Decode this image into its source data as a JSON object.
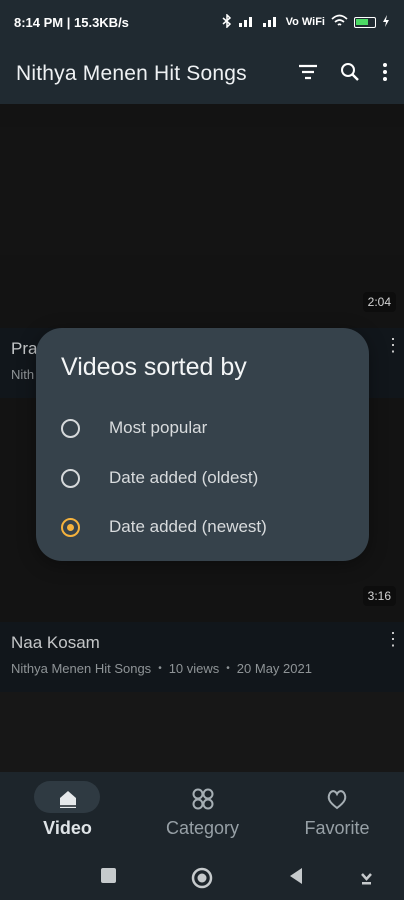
{
  "status": {
    "time_info": "8:14 PM | 15.3KB/s",
    "network": "Vo WiFi"
  },
  "appbar": {
    "title": "Nithya Menen Hit Songs",
    "icons": [
      "sort-icon",
      "search-icon",
      "more-vert-icon"
    ]
  },
  "videos": [
    {
      "title": "Pra",
      "meta_prefix": "Nith",
      "duration": "2:04"
    },
    {
      "title": "Naa Kosam",
      "channel": "Nithya Menen Hit Songs",
      "views": "10 views",
      "date": "20 May 2021",
      "duration": "3:16"
    }
  ],
  "dialog": {
    "title": "Videos sorted by",
    "options": [
      {
        "label": "Most popular",
        "selected": false
      },
      {
        "label": "Date added (oldest)",
        "selected": false
      },
      {
        "label": "Date added (newest)",
        "selected": true
      }
    ],
    "accent": "#f5b23d"
  },
  "bottom_nav": {
    "items": [
      {
        "label": "Video",
        "icon": "home-icon",
        "active": true
      },
      {
        "label": "Category",
        "icon": "grid-icon",
        "active": false
      },
      {
        "label": "Favorite",
        "icon": "heart-icon",
        "active": false
      }
    ]
  },
  "system_nav": {
    "icons": [
      "recent-apps-icon",
      "home-circle-icon",
      "back-icon",
      "drawer-icon"
    ]
  },
  "colors": {
    "appbar": "#202a31",
    "dialog": "#36424b",
    "background": "#1c1c1c"
  }
}
